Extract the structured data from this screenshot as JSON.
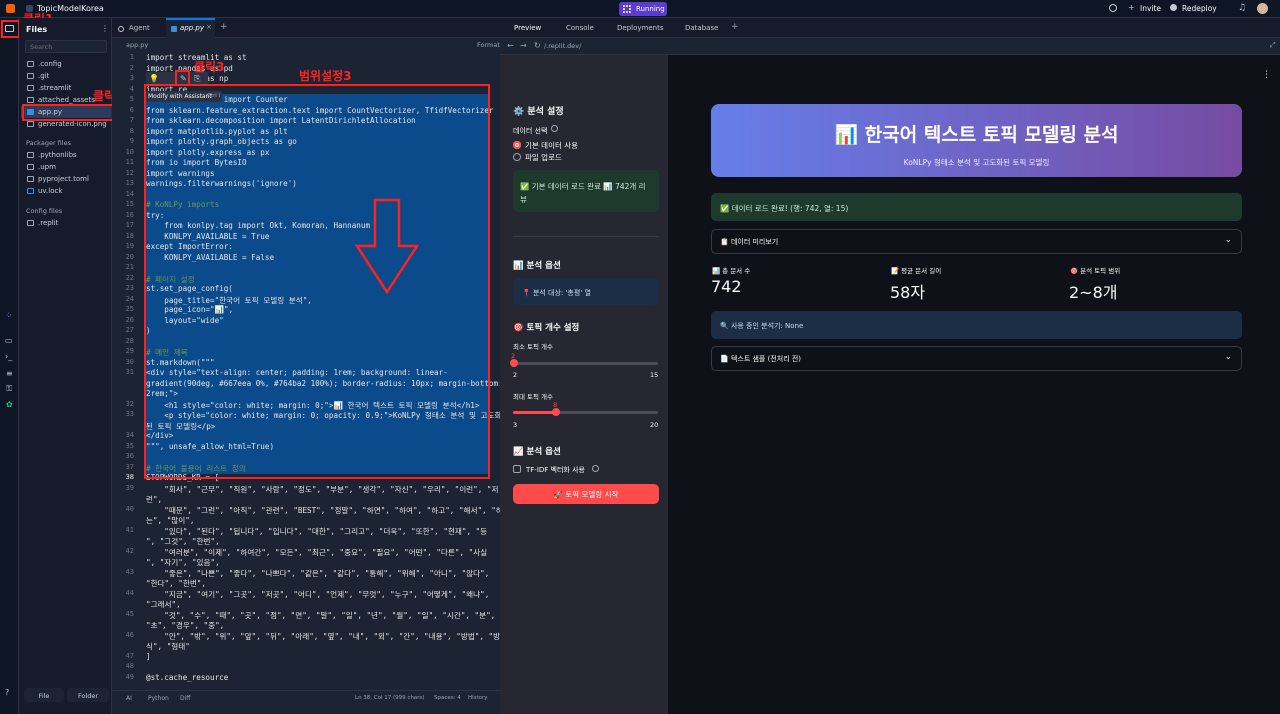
{
  "topbar": {
    "project_name": "TopicModelKorea",
    "run_label": "Running",
    "invite": "Invite",
    "redeploy": "Redeploy"
  },
  "files_panel": {
    "title": "Files",
    "search_placeholder": "Search",
    "items": [
      ".config",
      ".git",
      ".streamlit",
      "attached_assets",
      "app.py",
      "generated-icon.png"
    ],
    "packager_title": "Packager files",
    "packager_items": [
      ".pythonlibs",
      ".upm",
      "pyproject.toml",
      "uv.lock"
    ],
    "config_title": "Config files",
    "config_items": [
      ".replit"
    ],
    "bottom_file": "File",
    "bottom_folder": "Folder"
  },
  "editor": {
    "tab_agent": "Agent",
    "tab_app": "app.py",
    "breadcrumb": "app.py",
    "format": "Format",
    "tooltip": "Modify with Assistant",
    "tooltip_key": "Ctrl I",
    "status_ai": "AI",
    "status_python": "Python",
    "status_diff": "Diff",
    "status_pos": "Ln 38, Col 17 (999 chars)",
    "status_spaces": "Spaces: 4",
    "status_history": "History",
    "lines": [
      {
        "n": "1",
        "t": "import streamlit as st"
      },
      {
        "n": "2",
        "t": "import pandas as pd"
      },
      {
        "n": "3",
        "t": "import numpy as np"
      },
      {
        "n": "4",
        "t": "import re"
      },
      {
        "n": "5",
        "t": "from collections import Counter"
      },
      {
        "n": "6",
        "t": "from sklearn.feature_extraction.text import CountVectorizer, TfidfVectorizer"
      },
      {
        "n": "7",
        "t": "from sklearn.decomposition import LatentDirichletAllocation"
      },
      {
        "n": "8",
        "t": "import matplotlib.pyplot as plt"
      },
      {
        "n": "9",
        "t": "import plotly.graph_objects as go"
      },
      {
        "n": "10",
        "t": "import plotly.express as px"
      },
      {
        "n": "11",
        "t": "from io import BytesIO"
      },
      {
        "n": "12",
        "t": "import warnings"
      },
      {
        "n": "13",
        "t": "warnings.filterwarnings('ignore')"
      },
      {
        "n": "14",
        "t": ""
      },
      {
        "n": "15",
        "t": "# KoNLPy imports"
      },
      {
        "n": "16",
        "t": "try:"
      },
      {
        "n": "17",
        "t": "    from konlpy.tag import Okt, Komoran, Hannanum"
      },
      {
        "n": "18",
        "t": "    KONLPY_AVAILABLE = True"
      },
      {
        "n": "19",
        "t": "except ImportError:"
      },
      {
        "n": "20",
        "t": "    KONLPY_AVAILABLE = False"
      },
      {
        "n": "21",
        "t": ""
      },
      {
        "n": "22",
        "t": "# 페이지 설정"
      },
      {
        "n": "23",
        "t": "st.set_page_config("
      },
      {
        "n": "24",
        "t": "    page_title=\"한국어 토픽 모델링 분석\","
      },
      {
        "n": "25",
        "t": "    page_icon=\"📊\","
      },
      {
        "n": "26",
        "t": "    layout=\"wide\""
      },
      {
        "n": "27",
        "t": ")"
      },
      {
        "n": "28",
        "t": ""
      },
      {
        "n": "29",
        "t": "# 메인 제목"
      },
      {
        "n": "30",
        "t": "st.markdown(\"\"\""
      },
      {
        "n": "31",
        "t": "<div style=\"text-align: center; padding: 1rem; background: linear-"
      },
      {
        "n": "",
        "t": "gradient(90deg, #667eea 0%, #764ba2 100%); border-radius: 10px; margin-bottom:"
      },
      {
        "n": "",
        "t": "2rem;\">"
      },
      {
        "n": "32",
        "t": "    <h1 style=\"color: white; margin: 0;\">📊 한국어 텍스트 토픽 모델링 분석</h1>"
      },
      {
        "n": "33",
        "t": "    <p style=\"color: white; margin: 0; opacity: 0.9;\">KoNLPy 형태소 분석 및 고도화"
      },
      {
        "n": "",
        "t": "된 토픽 모델링</p>"
      },
      {
        "n": "34",
        "t": "</div>"
      },
      {
        "n": "35",
        "t": "\"\"\", unsafe_allow_html=True)"
      },
      {
        "n": "36",
        "t": ""
      },
      {
        "n": "37",
        "t": "# 한국어 불용어 리스트 정의"
      },
      {
        "n": "38",
        "t": "STOPWORDS_KR = ["
      },
      {
        "n": "39",
        "t": "    \"회사\", \"근무\", \"직원\", \"사람\", \"정도\", \"부분\", \"생각\", \"자신\", \"우리\", \"이런\", \"저"
      },
      {
        "n": "",
        "t": "런\","
      },
      {
        "n": "40",
        "t": "    \"때문\", \"그런\", \"아직\", \"관련\", \"BEST\", \"정말\", \"하면\", \"하여\", \"하고\", \"해서\", \"하"
      },
      {
        "n": "",
        "t": "는\", \"많이\","
      },
      {
        "n": "41",
        "t": "    \"있다\", \"된다\", \"됩니다\", \"입니다\", \"대한\", \"그리고\", \"더욱\", \"또한\", \"현재\", \"등"
      },
      {
        "n": "",
        "t": "\", \"그것\", \"한번\","
      },
      {
        "n": "42",
        "t": "    \"여러분\", \"이제\", \"하여간\", \"모든\", \"최근\", \"중요\", \"필요\", \"어떤\", \"다른\", \"사실"
      },
      {
        "n": "",
        "t": "\", \"자기\", \"있음\","
      },
      {
        "n": "43",
        "t": "    \"좋은\", \"나쁜\", \"좋다\", \"나쁘다\", \"같은\", \"같다\", \"통해\", \"위해\", \"아니\", \"않다\","
      },
      {
        "n": "",
        "t": "\"한다\", \"한번\","
      },
      {
        "n": "44",
        "t": "    \"지금\", \"여기\", \"그곳\", \"저곳\", \"어디\", \"언제\", \"무엇\", \"누구\", \"어떻게\", \"왜냐\","
      },
      {
        "n": "",
        "t": "\"그래서\","
      },
      {
        "n": "45",
        "t": "    \"것\", \"수\", \"때\", \"곳\", \"점\", \"면\", \"말\", \"일\", \"년\", \"월\", \"일\", \"시간\", \"분\","
      },
      {
        "n": "",
        "t": "\"초\", \"경우\", \"중\","
      },
      {
        "n": "46",
        "t": "    \"안\", \"밖\", \"위\", \"앞\", \"뒤\", \"아래\", \"옆\", \"내\", \"외\", \"간\", \"내용\", \"방법\", \"방"
      },
      {
        "n": "",
        "t": "식\", \"형태\""
      },
      {
        "n": "47",
        "t": "]"
      },
      {
        "n": "48",
        "t": ""
      },
      {
        "n": "49",
        "t": "@st.cache_resource"
      }
    ]
  },
  "annotations": {
    "click1": "클릭1",
    "click2": "클릭2",
    "click3": "클릭3",
    "range": "범위설정3"
  },
  "preview_tabs": {
    "preview": "Preview",
    "console": "Console",
    "deployments": "Deployments",
    "database": "Database"
  },
  "url": "/.replit.dev/",
  "sidebar": {
    "settings_title": "⚙️ 분석 설정",
    "data_select": "데이터 선택",
    "opt_default": "기본 데이터 사용",
    "opt_upload": "파일 업로드",
    "loaded_msg": "✅ 기본 데이터 로드 완료 📊 742개 리뷰",
    "analysis_options": "📊 분석 옵션",
    "target": "📍 분석 대상: '총평' 열",
    "topic_count": "🎯 토픽 개수 설정",
    "min_topics": "최소 토픽 개수",
    "min_val": "2",
    "min_lo": "2",
    "min_hi": "15",
    "max_topics": "최대 토픽 개수",
    "max_val": "8",
    "max_lo": "3",
    "max_hi": "20",
    "analysis_options2": "📈 분석 옵션",
    "tfidf": "TF-IDF 벡터화 사용",
    "start_btn": "🚀 토픽 모델링 시작"
  },
  "main": {
    "title": "📊 한국어 텍스트 토픽 모델링 분석",
    "subtitle": "KoNLPy 형태소 분석 및 고도화된 토픽 모델링",
    "loaded": "✅ 데이터 로드 완료! (행: 742, 열: 15)",
    "preview": "📋 데이터 미리보기",
    "m1_label": "📊 총 문서 수",
    "m1_val": "742",
    "m2_label": "📝 평균 문서 길이",
    "m2_val": "58자",
    "m3_label": "🎯 분석 토픽 범위",
    "m3_val": "2~8개",
    "analyzer": "🔍 사용 중인 분석기: None",
    "sample": "📄 텍스트 샘플 (전처리 전)"
  },
  "colors": {
    "accent": "#ff4b4b",
    "gradient_start": "#667eea",
    "gradient_end": "#764ba2",
    "selection": "#0b4a8b",
    "annotation": "#ff2020"
  }
}
